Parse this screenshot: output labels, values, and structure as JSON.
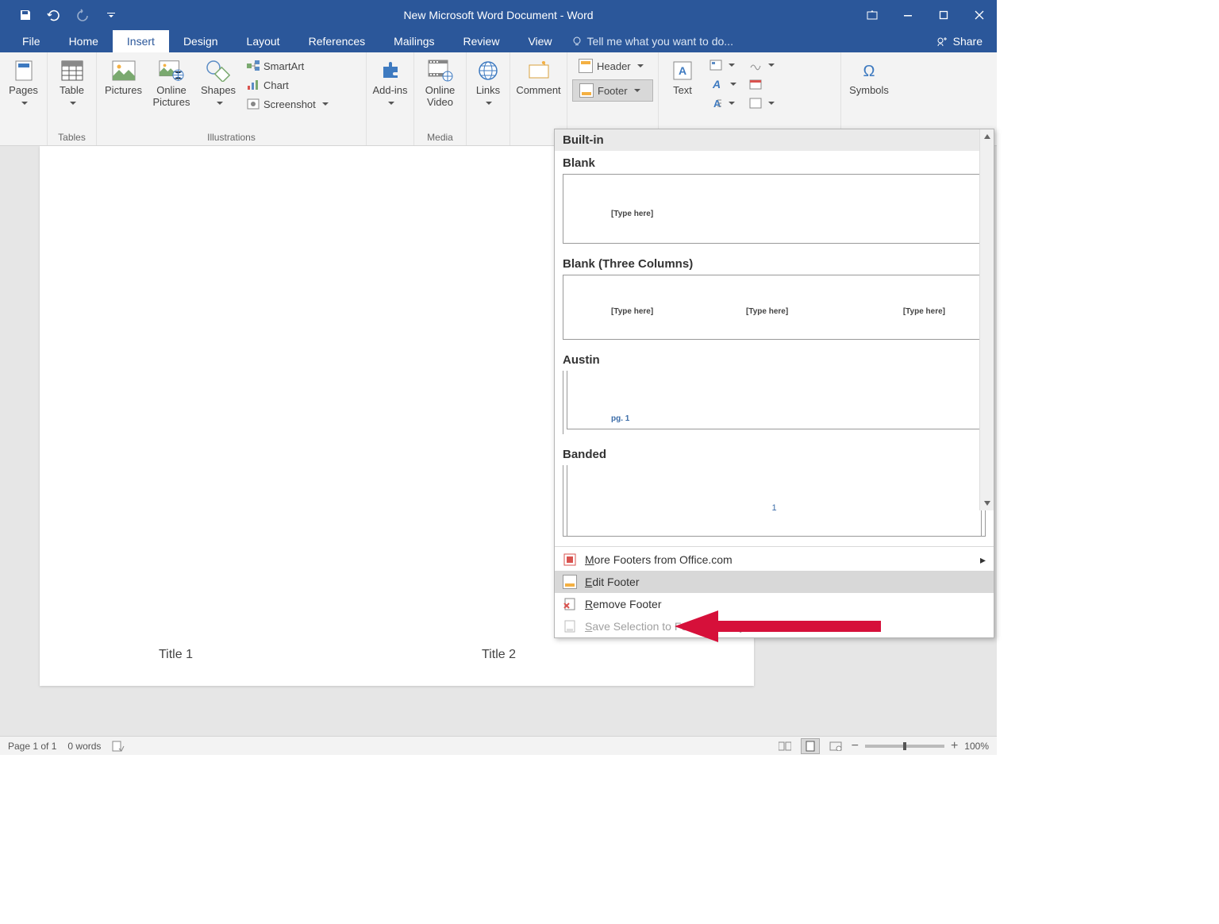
{
  "title": "New Microsoft Word Document - Word",
  "tabs": [
    "File",
    "Home",
    "Insert",
    "Design",
    "Layout",
    "References",
    "Mailings",
    "Review",
    "View"
  ],
  "active_tab": "Insert",
  "tell_me": "Tell me what you want to do...",
  "share": "Share",
  "ribbon": {
    "pages": {
      "label": "Pages"
    },
    "table": {
      "label": "Table"
    },
    "tables_group": "Tables",
    "pictures": {
      "label": "Pictures"
    },
    "online_pictures": {
      "label": "Online Pictures"
    },
    "shapes": {
      "label": "Shapes"
    },
    "smartart": "SmartArt",
    "chart": "Chart",
    "screenshot": "Screenshot",
    "illustrations_group": "Illustrations",
    "addins": {
      "label": "Add-ins"
    },
    "online_video": {
      "label": "Online Video"
    },
    "media_group": "Media",
    "links": {
      "label": "Links"
    },
    "comment": {
      "label": "Comment"
    },
    "header": "Header",
    "footer": "Footer",
    "text": "Text",
    "symbols": "Symbols"
  },
  "document": {
    "footer1": "Title 1",
    "footer2": "Title 2"
  },
  "dropdown": {
    "builtin": "Built-in",
    "blank": "Blank",
    "blank_ph": "[Type here]",
    "blank3": "Blank (Three Columns)",
    "austin": "Austin",
    "austin_pg": "pg. 1",
    "banded": "Banded",
    "banded_num": "1",
    "more": "More Footers from Office.com",
    "edit": "Edit Footer",
    "remove": "Remove Footer",
    "save_sel": "Save Selection to Footer Gallery..."
  },
  "statusbar": {
    "page": "Page 1 of 1",
    "words": "0 words",
    "zoom": "100%"
  }
}
